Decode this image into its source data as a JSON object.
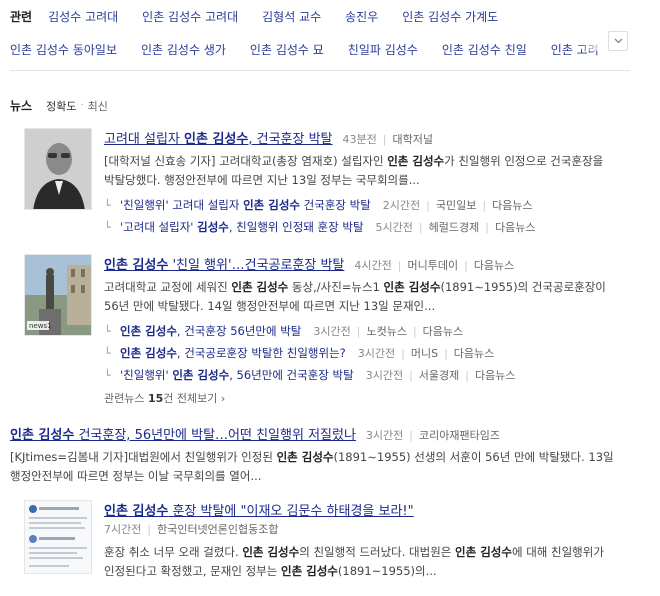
{
  "related": {
    "label": "관련",
    "row1": [
      "김성수 고려대",
      "인촌 김성수 고려대",
      "김형석 교수",
      "송진우",
      "인촌 김성수 가계도"
    ],
    "row2": [
      "인촌 김성수 동아일보",
      "인촌 김성수 생가",
      "인촌 김성수 묘",
      "친일파 김성수",
      "인촌 김성수 친일",
      "인촌 고려"
    ],
    "more_icon": "chevron-down-icon"
  },
  "news_header": {
    "title": "뉴스",
    "sort_accuracy": "정확도",
    "dot": "·",
    "sort_latest": "최신"
  },
  "items": [
    {
      "thumb": "portrait-photo",
      "title_pre": "고려대 설립자 ",
      "title_bold": "인촌 김성수",
      "title_post": ", 건국훈장 박탈",
      "time": "43분전",
      "source": "대학저널",
      "desc_html_parts": [
        "[대학저널 신효송 기자] 고려대학교(총장 염재호) 설립자인 ",
        "인촌 김성수",
        "가 친일행위 인정으로 건국훈장을 박탈당했다. 행정안전부에 따르면 지난 13일 정부는 국무회의를..."
      ],
      "subs": [
        {
          "pre": "'친일행위' 고려대 설립자 ",
          "bold": "인촌 김성수",
          "post": " 건국훈장 박탈",
          "time": "2시간전",
          "source": "국민일보",
          "extra": "다음뉴스"
        },
        {
          "pre": "'고려대 설립자' ",
          "bold": "김성수",
          "post": ", 친일행위 인정돼 훈장 박탈",
          "time": "5시간전",
          "source": "헤럴드경제",
          "extra": "다음뉴스"
        }
      ]
    },
    {
      "thumb": "statue-photo",
      "title_pre": "",
      "title_bold": "인촌 김성수",
      "title_post": " '친일 행위'…건국공로훈장 박탈",
      "time": "4시간전",
      "source": "머니투데이",
      "extra": "다음뉴스",
      "desc_html_parts": [
        "고려대학교 교정에 세워진 ",
        "인촌 김성수",
        " 동상,/사진=뉴스1 ",
        "인촌 김성수",
        "(1891∼1955)의 건국공로훈장이 56년 만에 박탈됐다. 14일 행정안전부에 따르면 지난 13일 문재인..."
      ],
      "subs": [
        {
          "pre": "",
          "bold": "인촌 김성수",
          "post": ", 건국훈장 56년만에 박탈",
          "time": "3시간전",
          "source": "노컷뉴스",
          "extra": "다음뉴스"
        },
        {
          "pre": "",
          "bold": "인촌 김성수",
          "post": ", 건국공로훈장 박탈한 친일행위는?",
          "time": "3시간전",
          "source": "머니S",
          "extra": "다음뉴스"
        },
        {
          "pre": "'친일행위' ",
          "bold": "인촌 김성수",
          "post": ", 56년만에 건국훈장 박탈",
          "time": "3시간전",
          "source": "서울경제",
          "extra": "다음뉴스"
        }
      ],
      "related_count_pre": "관련뉴스 ",
      "related_count_num": "15",
      "related_count_post": "건 전체보기 ›"
    },
    {
      "title_pre": "",
      "title_bold": "인촌 김성수",
      "title_post": " 건국훈장, 56년만에 박탈…어떤 친일행위 저질렀나",
      "time": "3시간전",
      "source": "코리아재팬타임즈",
      "desc_html_parts": [
        "[KJtimes=김봄내 기자]대법원에서 친일행위가 인정된 ",
        "인촌 김성수",
        "(1891∼1955) 선생의 서훈이 56년 만에 박탈됐다. 13일 행정안전부에 따르면 정부는 이날 국무회의를 열어..."
      ]
    },
    {
      "thumb": "document-screenshot",
      "title_pre": "",
      "title_bold": "인촌 김성수",
      "title_post": " 훈장 박탈에 \"이재오 김문수 하태경을 보라!\"",
      "time": "7시간전",
      "source": "한국인터넷언론인협동조합",
      "desc_html_parts": [
        "훈장 취소 너무 오래 걸렸다. ",
        "인촌 김성수",
        "의 친일행적 드러났다. 대법원은 ",
        "인촌 김성수",
        "에 대해 친일행위가 인정된다고 확정했고, 문재인 정부는 ",
        "인촌 김성수",
        "(1891~1955)의..."
      ]
    }
  ]
}
